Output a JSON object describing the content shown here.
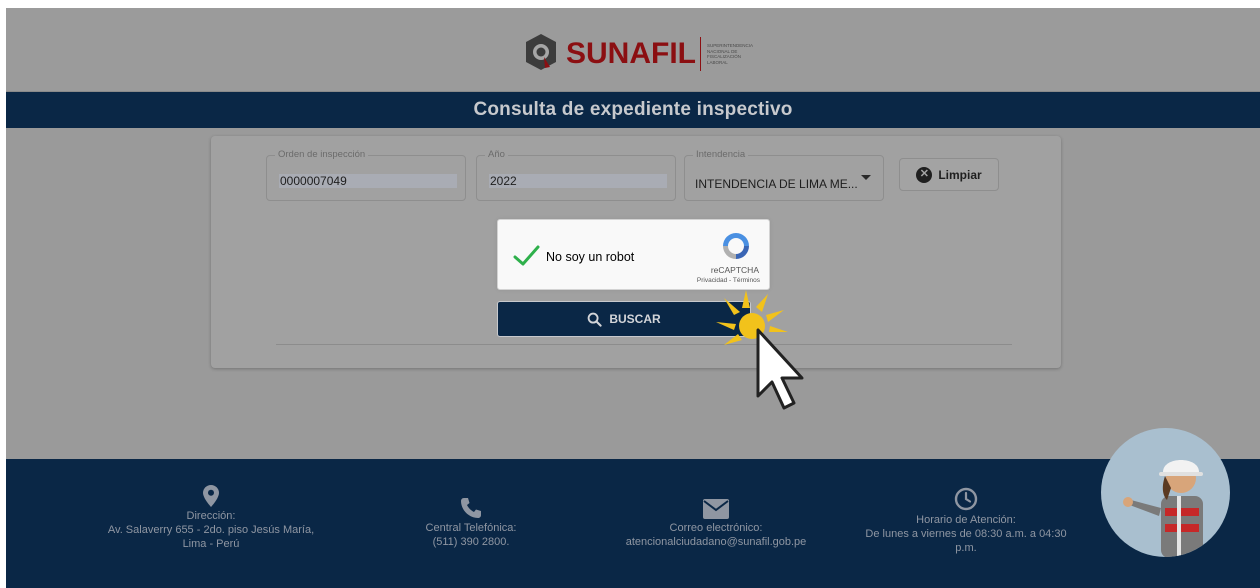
{
  "header": {
    "logo_text": "SUNAFIL",
    "logo_subtitle": "Superintendencia Nacional de Fiscalización Laboral"
  },
  "title": "Consulta de expediente inspectivo",
  "form": {
    "orden": {
      "label": "Orden de inspección",
      "value": "0000007049"
    },
    "anio": {
      "label": "Año",
      "value": "2022"
    },
    "intendencia": {
      "label": "Intendencia",
      "value": "INTENDENCIA DE LIMA ME..."
    },
    "clear_label": "Limpiar"
  },
  "captcha": {
    "text": "No soy un robot",
    "brand": "reCAPTCHA",
    "links": "Privacidad - Términos"
  },
  "search_label": "BUSCAR",
  "footer": {
    "direccion": {
      "title": "Dirección:",
      "line1": "Av. Salaverry 655 - 2do. piso Jesús María,",
      "line2": "Lima - Perú"
    },
    "telefono": {
      "title": "Central Telefónica:",
      "line1": "(511) 390 2800."
    },
    "correo": {
      "title": "Correo electrónico:",
      "line1": "atencionalciudadano@sunafil.gob.pe"
    },
    "horario": {
      "title": "Horario de Atención:",
      "line1": "De lunes a viernes de 08:30 a.m. a 04:30",
      "line2": "p.m."
    }
  },
  "colors": {
    "navy": "#0a2746",
    "brand_red": "#8b0f12",
    "overlay_gray": "#9a9a9a",
    "captcha_check": "#2eb04b"
  },
  "icons": {
    "clear": "x-circle-icon",
    "search": "search-icon",
    "direccion": "map-pin-icon",
    "telefono": "phone-icon",
    "correo": "envelope-icon",
    "horario": "clock-icon"
  }
}
